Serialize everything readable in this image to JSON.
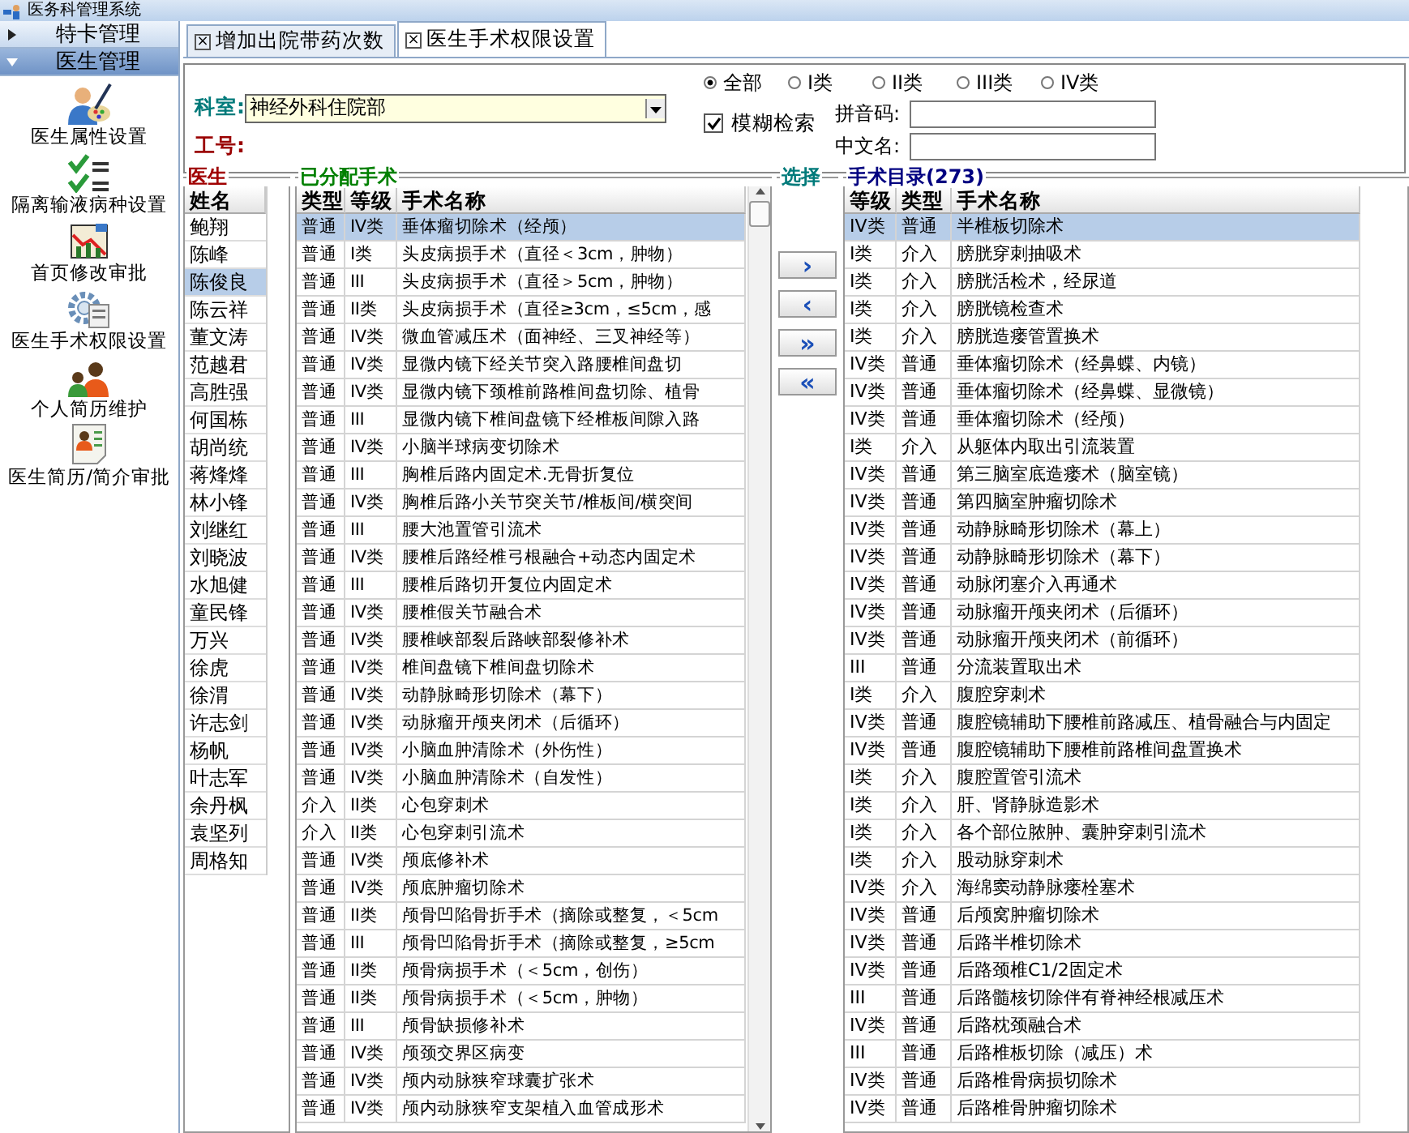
{
  "window": {
    "title": "医务科管理系统"
  },
  "sidebar": {
    "groups": [
      {
        "label": "特卡管理",
        "expanded": false
      },
      {
        "label": "医生管理",
        "expanded": true,
        "items": [
          {
            "label": "医生属性设置",
            "kind": "palette"
          },
          {
            "label": "隔离输液病种设置",
            "kind": "checklist"
          },
          {
            "label": "首页修改审批",
            "kind": "chart"
          },
          {
            "label": "医生手术权限设置",
            "kind": "gear"
          },
          {
            "label": "个人简历维护",
            "kind": "people"
          },
          {
            "label": "医生简历/简介审批",
            "kind": "document"
          }
        ]
      }
    ]
  },
  "tabs": [
    {
      "label": "增加出院带药次数",
      "selected": false,
      "close": "×"
    },
    {
      "label": "医生手术权限设置",
      "selected": true,
      "close": "×"
    }
  ],
  "filter": {
    "department_label": "科室:",
    "department": "神经外科住院部",
    "staff_label": "工号:",
    "grades": [
      {
        "label": "全部",
        "selected": true
      },
      {
        "label": "I类",
        "selected": false
      },
      {
        "label": "II类",
        "selected": false
      },
      {
        "label": "III类",
        "selected": false
      },
      {
        "label": "IV类",
        "selected": false
      }
    ],
    "fuzzy": {
      "label": "模糊检索",
      "checked": true
    },
    "pinyin_label": "拼音码:",
    "chinese_label": "中文名:"
  },
  "doctors": {
    "title": "医生",
    "column": "姓名",
    "rows": [
      {
        "name": "鲍翔",
        "selected": false
      },
      {
        "name": "陈峰",
        "selected": false
      },
      {
        "name": "陈俊良",
        "selected": true
      },
      {
        "name": "陈云祥",
        "selected": false
      },
      {
        "name": "董文涛",
        "selected": false
      },
      {
        "name": "范越君",
        "selected": false
      },
      {
        "name": "高胜强",
        "selected": false
      },
      {
        "name": "何国栋",
        "selected": false
      },
      {
        "name": "胡尚统",
        "selected": false
      },
      {
        "name": "蒋烽烽",
        "selected": false
      },
      {
        "name": "林小锋",
        "selected": false
      },
      {
        "name": "刘继红",
        "selected": false
      },
      {
        "name": "刘晓波",
        "selected": false
      },
      {
        "name": "水旭健",
        "selected": false
      },
      {
        "name": "童民锋",
        "selected": false
      },
      {
        "name": "万兴",
        "selected": false
      },
      {
        "name": "徐虎",
        "selected": false
      },
      {
        "name": "徐渭",
        "selected": false
      },
      {
        "name": "许志剑",
        "selected": false
      },
      {
        "name": "杨帆",
        "selected": false
      },
      {
        "name": "叶志军",
        "selected": false
      },
      {
        "name": "余丹枫",
        "selected": false
      },
      {
        "name": "袁坚列",
        "selected": false
      },
      {
        "name": "周格知",
        "selected": false
      }
    ]
  },
  "assigned": {
    "title": "已分配手术",
    "columns": [
      "类型",
      "等级",
      "手术名称"
    ],
    "rows": [
      {
        "cells": [
          "普通",
          "IV类",
          "垂体瘤切除术（经颅）"
        ],
        "selected": true
      },
      {
        "cells": [
          "普通",
          "I类",
          "头皮病损手术（直径＜3cm，肿物）"
        ],
        "selected": false
      },
      {
        "cells": [
          "普通",
          "III",
          "头皮病损手术（直径＞5cm，肿物）"
        ],
        "selected": false
      },
      {
        "cells": [
          "普通",
          "II类",
          "头皮病损手术（直径≥3cm，≤5cm，感"
        ],
        "selected": false
      },
      {
        "cells": [
          "普通",
          "IV类",
          "微血管减压术（面神经、三叉神经等）"
        ],
        "selected": false
      },
      {
        "cells": [
          "普通",
          "IV类",
          "显微内镜下经关节突入路腰椎间盘切"
        ],
        "selected": false
      },
      {
        "cells": [
          "普通",
          "IV类",
          "显微内镜下颈椎前路椎间盘切除、植骨"
        ],
        "selected": false
      },
      {
        "cells": [
          "普通",
          "III",
          "显微内镜下椎间盘镜下经椎板间隙入路"
        ],
        "selected": false
      },
      {
        "cells": [
          "普通",
          "IV类",
          "小脑半球病变切除术"
        ],
        "selected": false
      },
      {
        "cells": [
          "普通",
          "III",
          "胸椎后路内固定术.无骨折复位"
        ],
        "selected": false
      },
      {
        "cells": [
          "普通",
          "IV类",
          "胸椎后路小关节突关节/椎板间/横突间"
        ],
        "selected": false
      },
      {
        "cells": [
          "普通",
          "III",
          "腰大池置管引流术"
        ],
        "selected": false
      },
      {
        "cells": [
          "普通",
          "IV类",
          "腰椎后路经椎弓根融合+动态内固定术"
        ],
        "selected": false
      },
      {
        "cells": [
          "普通",
          "III",
          "腰椎后路切开复位内固定术"
        ],
        "selected": false
      },
      {
        "cells": [
          "普通",
          "IV类",
          "腰椎假关节融合术"
        ],
        "selected": false
      },
      {
        "cells": [
          "普通",
          "IV类",
          "腰椎峡部裂后路峡部裂修补术"
        ],
        "selected": false
      },
      {
        "cells": [
          "普通",
          "IV类",
          "椎间盘镜下椎间盘切除术"
        ],
        "selected": false
      },
      {
        "cells": [
          "普通",
          "IV类",
          "动静脉畸形切除术（幕下）"
        ],
        "selected": false
      },
      {
        "cells": [
          "普通",
          "IV类",
          "动脉瘤开颅夹闭术（后循环）"
        ],
        "selected": false
      },
      {
        "cells": [
          "普通",
          "IV类",
          "小脑血肿清除术（外伤性）"
        ],
        "selected": false
      },
      {
        "cells": [
          "普通",
          "IV类",
          "小脑血肿清除术（自发性）"
        ],
        "selected": false
      },
      {
        "cells": [
          "介入",
          "II类",
          "心包穿刺术"
        ],
        "selected": false
      },
      {
        "cells": [
          "介入",
          "II类",
          "心包穿刺引流术"
        ],
        "selected": false
      },
      {
        "cells": [
          "普通",
          "IV类",
          "颅底修补术"
        ],
        "selected": false
      },
      {
        "cells": [
          "普通",
          "IV类",
          "颅底肿瘤切除术"
        ],
        "selected": false
      },
      {
        "cells": [
          "普通",
          "II类",
          "颅骨凹陷骨折手术（摘除或整复，＜5cm"
        ],
        "selected": false
      },
      {
        "cells": [
          "普通",
          "III",
          "颅骨凹陷骨折手术（摘除或整复，≥5cm"
        ],
        "selected": false
      },
      {
        "cells": [
          "普通",
          "II类",
          "颅骨病损手术（＜5cm，创伤）"
        ],
        "selected": false
      },
      {
        "cells": [
          "普通",
          "II类",
          "颅骨病损手术（＜5cm，肿物）"
        ],
        "selected": false
      },
      {
        "cells": [
          "普通",
          "III",
          "颅骨缺损修补术"
        ],
        "selected": false
      },
      {
        "cells": [
          "普通",
          "IV类",
          "颅颈交界区病变"
        ],
        "selected": false
      },
      {
        "cells": [
          "普通",
          "IV类",
          "颅内动脉狭窄球囊扩张术"
        ],
        "selected": false
      },
      {
        "cells": [
          "普通",
          "IV类",
          "颅内动脉狭窄支架植入血管成形术"
        ],
        "selected": false
      }
    ]
  },
  "select": {
    "title": "选择",
    "buttons": [
      {
        "label": "›"
      },
      {
        "label": "‹"
      },
      {
        "label": "»"
      },
      {
        "label": "«"
      }
    ]
  },
  "catalog": {
    "title": "手术目录(273)",
    "columns": [
      "等级",
      "类型",
      "手术名称"
    ],
    "rows": [
      {
        "cells": [
          "IV类",
          "普通",
          "半椎板切除术"
        ],
        "selected": true
      },
      {
        "cells": [
          "I类",
          "介入",
          "膀胱穿刺抽吸术"
        ],
        "selected": false
      },
      {
        "cells": [
          "I类",
          "介入",
          "膀胱活检术，经尿道"
        ],
        "selected": false
      },
      {
        "cells": [
          "I类",
          "介入",
          "膀胱镜检查术"
        ],
        "selected": false
      },
      {
        "cells": [
          "I类",
          "介入",
          "膀胱造瘘管置换术"
        ],
        "selected": false
      },
      {
        "cells": [
          "IV类",
          "普通",
          "垂体瘤切除术（经鼻蝶、内镜）"
        ],
        "selected": false
      },
      {
        "cells": [
          "IV类",
          "普通",
          "垂体瘤切除术（经鼻蝶、显微镜）"
        ],
        "selected": false
      },
      {
        "cells": [
          "IV类",
          "普通",
          "垂体瘤切除术（经颅）"
        ],
        "selected": false
      },
      {
        "cells": [
          "I类",
          "介入",
          "从躯体内取出引流装置"
        ],
        "selected": false
      },
      {
        "cells": [
          "IV类",
          "普通",
          "第三脑室底造瘘术（脑室镜）"
        ],
        "selected": false
      },
      {
        "cells": [
          "IV类",
          "普通",
          "第四脑室肿瘤切除术"
        ],
        "selected": false
      },
      {
        "cells": [
          "IV类",
          "普通",
          "动静脉畸形切除术（幕上）"
        ],
        "selected": false
      },
      {
        "cells": [
          "IV类",
          "普通",
          "动静脉畸形切除术（幕下）"
        ],
        "selected": false
      },
      {
        "cells": [
          "IV类",
          "普通",
          "动脉闭塞介入再通术"
        ],
        "selected": false
      },
      {
        "cells": [
          "IV类",
          "普通",
          "动脉瘤开颅夹闭术（后循环）"
        ],
        "selected": false
      },
      {
        "cells": [
          "IV类",
          "普通",
          "动脉瘤开颅夹闭术（前循环）"
        ],
        "selected": false
      },
      {
        "cells": [
          "III",
          "普通",
          "分流装置取出术"
        ],
        "selected": false
      },
      {
        "cells": [
          "I类",
          "介入",
          "腹腔穿刺术"
        ],
        "selected": false
      },
      {
        "cells": [
          "IV类",
          "普通",
          "腹腔镜辅助下腰椎前路减压、植骨融合与内固定"
        ],
        "selected": false
      },
      {
        "cells": [
          "IV类",
          "普通",
          "腹腔镜辅助下腰椎前路椎间盘置换术"
        ],
        "selected": false
      },
      {
        "cells": [
          "I类",
          "介入",
          "腹腔置管引流术"
        ],
        "selected": false
      },
      {
        "cells": [
          "I类",
          "介入",
          "肝、肾静脉造影术"
        ],
        "selected": false
      },
      {
        "cells": [
          "I类",
          "介入",
          "各个部位脓肿、囊肿穿刺引流术"
        ],
        "selected": false
      },
      {
        "cells": [
          "I类",
          "介入",
          "股动脉穿刺术"
        ],
        "selected": false
      },
      {
        "cells": [
          "IV类",
          "介入",
          "海绵窦动静脉瘘栓塞术"
        ],
        "selected": false
      },
      {
        "cells": [
          "IV类",
          "普通",
          "后颅窝肿瘤切除术"
        ],
        "selected": false
      },
      {
        "cells": [
          "IV类",
          "普通",
          "后路半椎切除术"
        ],
        "selected": false
      },
      {
        "cells": [
          "IV类",
          "普通",
          "后路颈椎C1/2固定术"
        ],
        "selected": false
      },
      {
        "cells": [
          "III",
          "普通",
          "后路髓核切除伴有脊神经根减压术"
        ],
        "selected": false
      },
      {
        "cells": [
          "IV类",
          "普通",
          "后路枕颈融合术"
        ],
        "selected": false
      },
      {
        "cells": [
          "III",
          "普通",
          "后路椎板切除（减压）术"
        ],
        "selected": false
      },
      {
        "cells": [
          "IV类",
          "普通",
          "后路椎骨病损切除术"
        ],
        "selected": false
      },
      {
        "cells": [
          "IV类",
          "普通",
          "后路椎骨肿瘤切除术"
        ],
        "selected": false
      }
    ]
  }
}
